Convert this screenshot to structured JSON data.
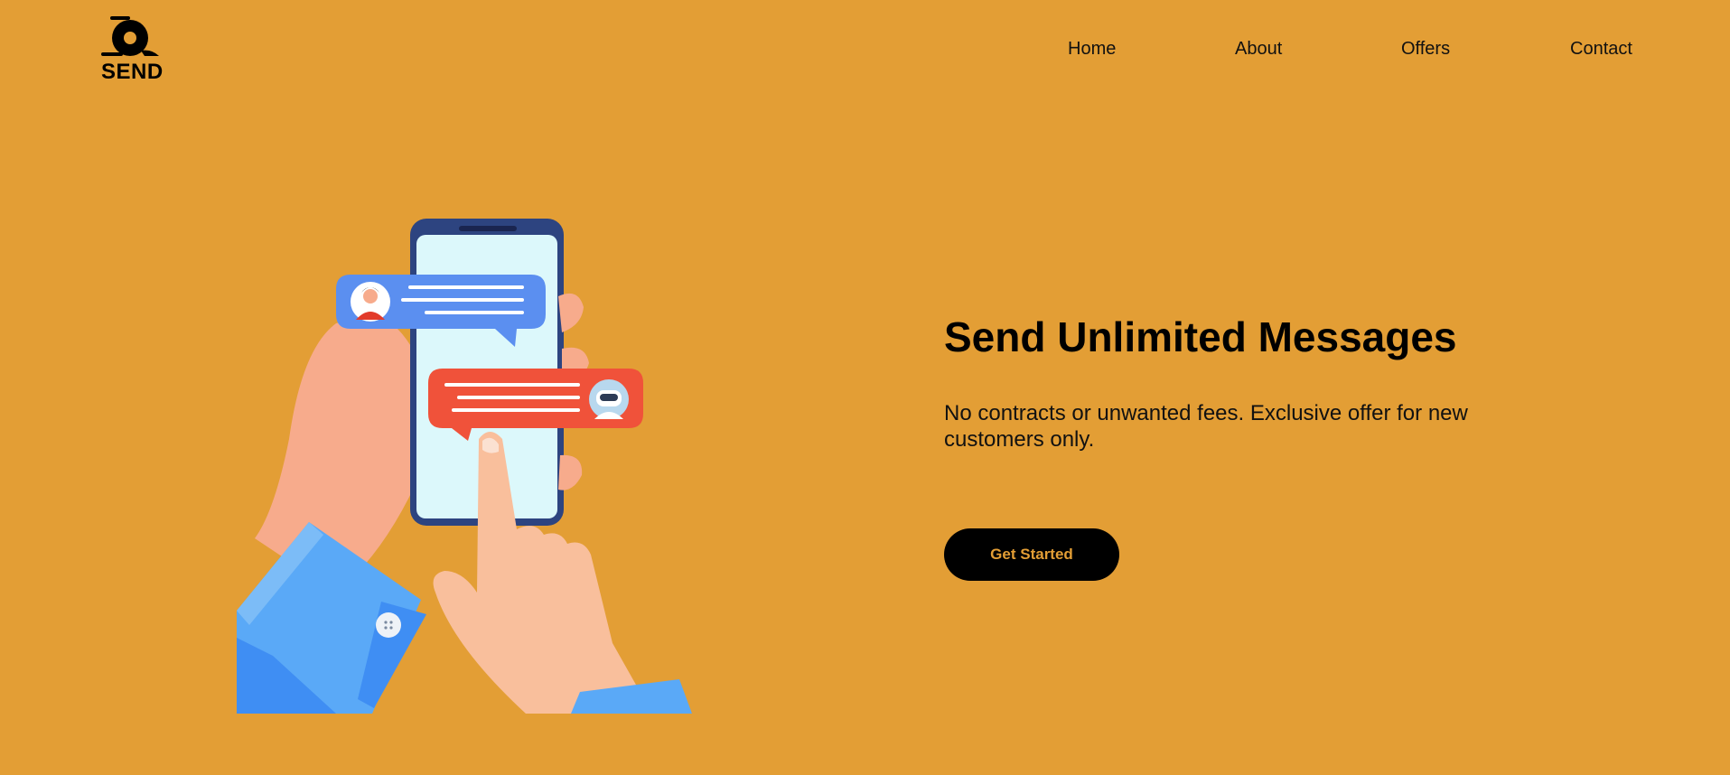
{
  "brand": {
    "logo_text": "SEND"
  },
  "nav": {
    "items": [
      {
        "label": "Home"
      },
      {
        "label": "About"
      },
      {
        "label": "Offers"
      },
      {
        "label": "Contact"
      }
    ]
  },
  "hero": {
    "headline": "Send Unlimited Messages",
    "subtext": "No contracts or unwanted fees. Exclusive offer for new customers only.",
    "cta_label": "Get Started",
    "illustration_icon": "phone-chat-illustration"
  },
  "colors": {
    "background": "#e39e35",
    "text": "#000000",
    "button_bg": "#000000",
    "button_text": "#e39e35",
    "bubble_blue": "#5b8ff0",
    "bubble_red": "#f0523a"
  }
}
